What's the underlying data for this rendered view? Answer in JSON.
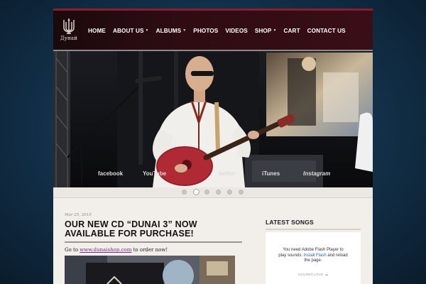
{
  "logo": {
    "text": "Дунай"
  },
  "nav": [
    {
      "label": "HOME",
      "dropdown": false
    },
    {
      "label": "ABOUT US",
      "dropdown": true
    },
    {
      "label": "ALBUMS",
      "dropdown": true
    },
    {
      "label": "PHOTOS",
      "dropdown": false
    },
    {
      "label": "VIDEOS",
      "dropdown": false
    },
    {
      "label": "SHOP",
      "dropdown": true
    },
    {
      "label": "CART",
      "dropdown": false
    },
    {
      "label": "CONTACT US",
      "dropdown": false
    }
  ],
  "slider": {
    "social_links": [
      "facebook",
      "YouTube",
      "twitter",
      "iTunes",
      "Instagram"
    ],
    "slide_count": 6,
    "active_slide": 1
  },
  "post": {
    "date": "Mar 25, 2015",
    "title": "OUR NEW CD “DUNAI 3” NOW AVAILABLE FOR PURCHASE!",
    "body_prefix": "Go to ",
    "link_text": "www.dunaishop.com",
    "body_suffix": " to order now!"
  },
  "sidebar": {
    "heading": "LATEST SONGS",
    "flash_message_1": "You need Adobe Flash Player to play sounds. ",
    "flash_link": "Install Flash",
    "flash_message_2": " and reload the page.",
    "soundcloud_label": "SOUNDCLOUD"
  },
  "colors": {
    "header_bg": "#2e0c12",
    "accent": "#8a1e2a",
    "page_bg": "#f2efea",
    "link": "#7a2a8a",
    "flash_link": "#2a5fb0"
  }
}
